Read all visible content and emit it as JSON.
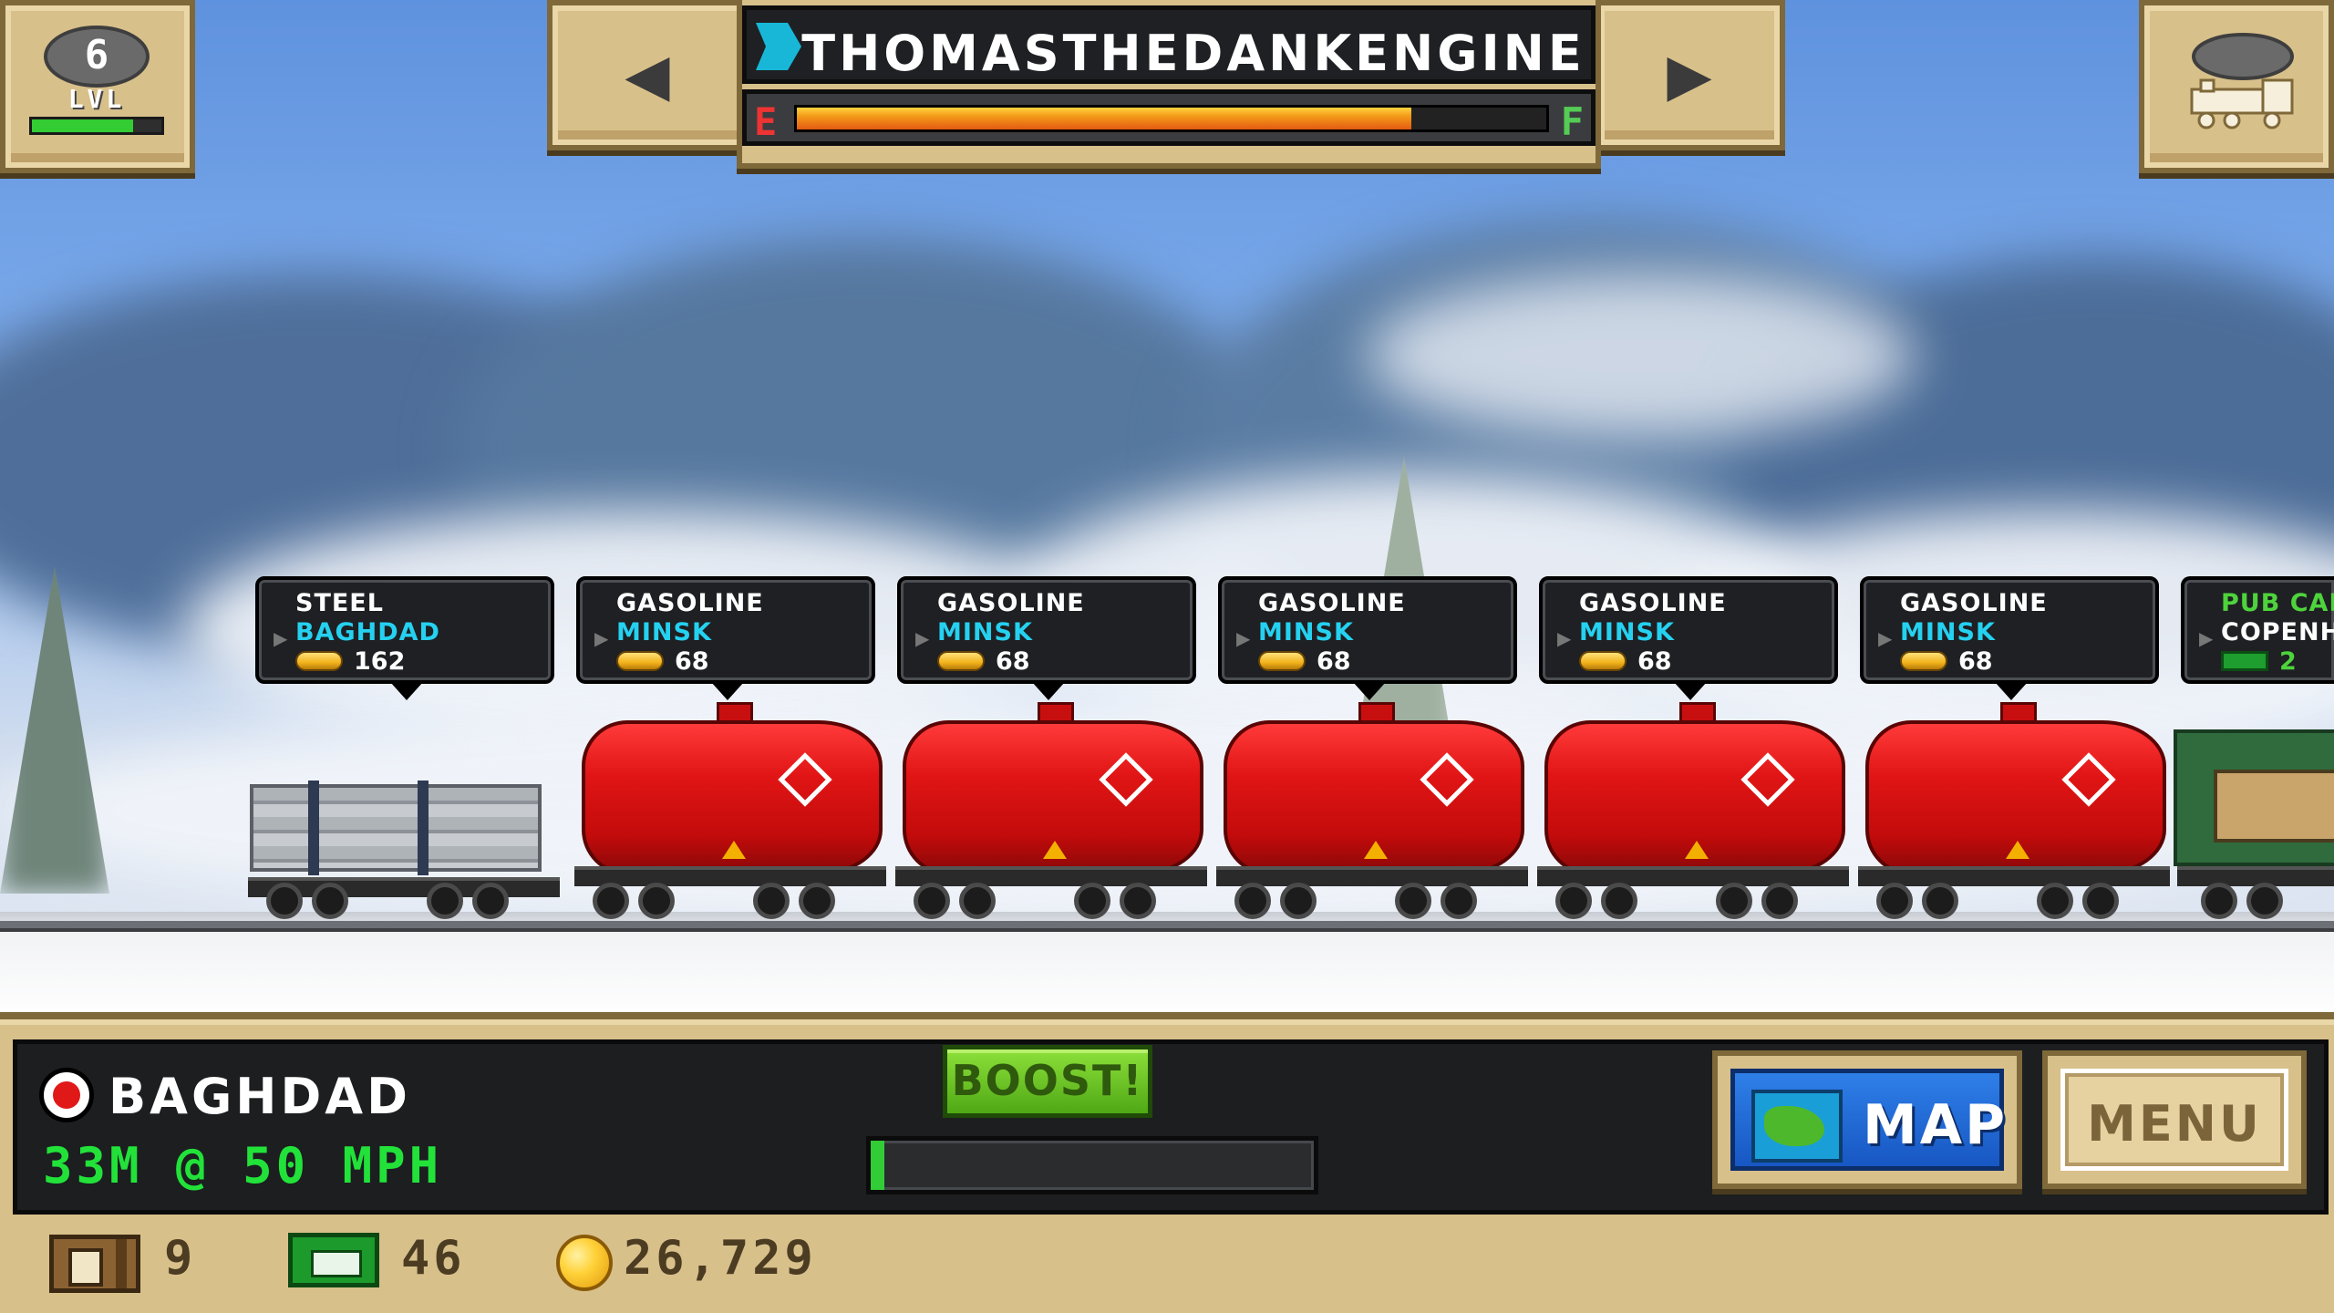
{
  "hud": {
    "level": "6",
    "level_label": "LVL",
    "level_progress": 0.78,
    "train_name": "THOMASTHEDANKENGINE",
    "fuel_empty_label": "E",
    "fuel_full_label": "F",
    "fuel_level": 0.82
  },
  "cars": [
    {
      "cargo": "STEEL",
      "destination": "BAGHDAD",
      "payout": "162",
      "reward": "coins",
      "type": "steel"
    },
    {
      "cargo": "GASOLINE",
      "destination": "MINSK",
      "payout": "68",
      "reward": "coins",
      "type": "tank"
    },
    {
      "cargo": "GASOLINE",
      "destination": "MINSK",
      "payout": "68",
      "reward": "coins",
      "type": "tank"
    },
    {
      "cargo": "GASOLINE",
      "destination": "MINSK",
      "payout": "68",
      "reward": "coins",
      "type": "tank"
    },
    {
      "cargo": "GASOLINE",
      "destination": "MINSK",
      "payout": "68",
      "reward": "coins",
      "type": "tank"
    },
    {
      "cargo": "GASOLINE",
      "destination": "MINSK",
      "payout": "68",
      "reward": "coins",
      "type": "tank"
    },
    {
      "cargo": "PUB CAR",
      "destination": "COPENHA",
      "payout": "2",
      "reward": "cash",
      "type": "pub"
    }
  ],
  "status": {
    "station": "BAGHDAD",
    "distance_speed": "33M @ 50 MPH",
    "boost_label": "BOOST!",
    "boost_progress": 0.03,
    "map_label": "MAP",
    "menu_label": "MENU"
  },
  "currency": {
    "crates": "9",
    "bux": "46",
    "coins": "26,729"
  },
  "colors": {
    "panel_tan": "#d8c08b",
    "destination_cyan": "#25d1f0",
    "status_green": "#22e23a",
    "tank_red": "#e11515"
  },
  "icons": {
    "level": "level-badge-icon",
    "train": "train-select-icon",
    "station": "station-marker-icon",
    "crate": "crate-icon",
    "cash": "cash-icon",
    "coin": "coin-icon"
  }
}
